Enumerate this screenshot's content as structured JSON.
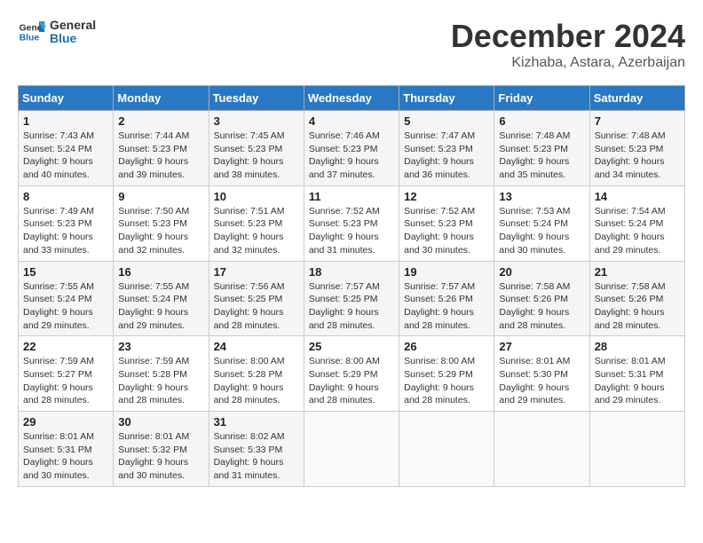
{
  "header": {
    "logo_general": "General",
    "logo_blue": "Blue",
    "month_title": "December 2024",
    "subtitle": "Kizhaba, Astara, Azerbaijan"
  },
  "weekdays": [
    "Sunday",
    "Monday",
    "Tuesday",
    "Wednesday",
    "Thursday",
    "Friday",
    "Saturday"
  ],
  "weeks": [
    [
      {
        "day": "1",
        "sunrise": "Sunrise: 7:43 AM",
        "sunset": "Sunset: 5:24 PM",
        "daylight": "Daylight: 9 hours and 40 minutes."
      },
      {
        "day": "2",
        "sunrise": "Sunrise: 7:44 AM",
        "sunset": "Sunset: 5:23 PM",
        "daylight": "Daylight: 9 hours and 39 minutes."
      },
      {
        "day": "3",
        "sunrise": "Sunrise: 7:45 AM",
        "sunset": "Sunset: 5:23 PM",
        "daylight": "Daylight: 9 hours and 38 minutes."
      },
      {
        "day": "4",
        "sunrise": "Sunrise: 7:46 AM",
        "sunset": "Sunset: 5:23 PM",
        "daylight": "Daylight: 9 hours and 37 minutes."
      },
      {
        "day": "5",
        "sunrise": "Sunrise: 7:47 AM",
        "sunset": "Sunset: 5:23 PM",
        "daylight": "Daylight: 9 hours and 36 minutes."
      },
      {
        "day": "6",
        "sunrise": "Sunrise: 7:48 AM",
        "sunset": "Sunset: 5:23 PM",
        "daylight": "Daylight: 9 hours and 35 minutes."
      },
      {
        "day": "7",
        "sunrise": "Sunrise: 7:48 AM",
        "sunset": "Sunset: 5:23 PM",
        "daylight": "Daylight: 9 hours and 34 minutes."
      }
    ],
    [
      {
        "day": "8",
        "sunrise": "Sunrise: 7:49 AM",
        "sunset": "Sunset: 5:23 PM",
        "daylight": "Daylight: 9 hours and 33 minutes."
      },
      {
        "day": "9",
        "sunrise": "Sunrise: 7:50 AM",
        "sunset": "Sunset: 5:23 PM",
        "daylight": "Daylight: 9 hours and 32 minutes."
      },
      {
        "day": "10",
        "sunrise": "Sunrise: 7:51 AM",
        "sunset": "Sunset: 5:23 PM",
        "daylight": "Daylight: 9 hours and 32 minutes."
      },
      {
        "day": "11",
        "sunrise": "Sunrise: 7:52 AM",
        "sunset": "Sunset: 5:23 PM",
        "daylight": "Daylight: 9 hours and 31 minutes."
      },
      {
        "day": "12",
        "sunrise": "Sunrise: 7:52 AM",
        "sunset": "Sunset: 5:23 PM",
        "daylight": "Daylight: 9 hours and 30 minutes."
      },
      {
        "day": "13",
        "sunrise": "Sunrise: 7:53 AM",
        "sunset": "Sunset: 5:24 PM",
        "daylight": "Daylight: 9 hours and 30 minutes."
      },
      {
        "day": "14",
        "sunrise": "Sunrise: 7:54 AM",
        "sunset": "Sunset: 5:24 PM",
        "daylight": "Daylight: 9 hours and 29 minutes."
      }
    ],
    [
      {
        "day": "15",
        "sunrise": "Sunrise: 7:55 AM",
        "sunset": "Sunset: 5:24 PM",
        "daylight": "Daylight: 9 hours and 29 minutes."
      },
      {
        "day": "16",
        "sunrise": "Sunrise: 7:55 AM",
        "sunset": "Sunset: 5:24 PM",
        "daylight": "Daylight: 9 hours and 29 minutes."
      },
      {
        "day": "17",
        "sunrise": "Sunrise: 7:56 AM",
        "sunset": "Sunset: 5:25 PM",
        "daylight": "Daylight: 9 hours and 28 minutes."
      },
      {
        "day": "18",
        "sunrise": "Sunrise: 7:57 AM",
        "sunset": "Sunset: 5:25 PM",
        "daylight": "Daylight: 9 hours and 28 minutes."
      },
      {
        "day": "19",
        "sunrise": "Sunrise: 7:57 AM",
        "sunset": "Sunset: 5:26 PM",
        "daylight": "Daylight: 9 hours and 28 minutes."
      },
      {
        "day": "20",
        "sunrise": "Sunrise: 7:58 AM",
        "sunset": "Sunset: 5:26 PM",
        "daylight": "Daylight: 9 hours and 28 minutes."
      },
      {
        "day": "21",
        "sunrise": "Sunrise: 7:58 AM",
        "sunset": "Sunset: 5:26 PM",
        "daylight": "Daylight: 9 hours and 28 minutes."
      }
    ],
    [
      {
        "day": "22",
        "sunrise": "Sunrise: 7:59 AM",
        "sunset": "Sunset: 5:27 PM",
        "daylight": "Daylight: 9 hours and 28 minutes."
      },
      {
        "day": "23",
        "sunrise": "Sunrise: 7:59 AM",
        "sunset": "Sunset: 5:28 PM",
        "daylight": "Daylight: 9 hours and 28 minutes."
      },
      {
        "day": "24",
        "sunrise": "Sunrise: 8:00 AM",
        "sunset": "Sunset: 5:28 PM",
        "daylight": "Daylight: 9 hours and 28 minutes."
      },
      {
        "day": "25",
        "sunrise": "Sunrise: 8:00 AM",
        "sunset": "Sunset: 5:29 PM",
        "daylight": "Daylight: 9 hours and 28 minutes."
      },
      {
        "day": "26",
        "sunrise": "Sunrise: 8:00 AM",
        "sunset": "Sunset: 5:29 PM",
        "daylight": "Daylight: 9 hours and 28 minutes."
      },
      {
        "day": "27",
        "sunrise": "Sunrise: 8:01 AM",
        "sunset": "Sunset: 5:30 PM",
        "daylight": "Daylight: 9 hours and 29 minutes."
      },
      {
        "day": "28",
        "sunrise": "Sunrise: 8:01 AM",
        "sunset": "Sunset: 5:31 PM",
        "daylight": "Daylight: 9 hours and 29 minutes."
      }
    ],
    [
      {
        "day": "29",
        "sunrise": "Sunrise: 8:01 AM",
        "sunset": "Sunset: 5:31 PM",
        "daylight": "Daylight: 9 hours and 30 minutes."
      },
      {
        "day": "30",
        "sunrise": "Sunrise: 8:01 AM",
        "sunset": "Sunset: 5:32 PM",
        "daylight": "Daylight: 9 hours and 30 minutes."
      },
      {
        "day": "31",
        "sunrise": "Sunrise: 8:02 AM",
        "sunset": "Sunset: 5:33 PM",
        "daylight": "Daylight: 9 hours and 31 minutes."
      },
      null,
      null,
      null,
      null
    ]
  ]
}
